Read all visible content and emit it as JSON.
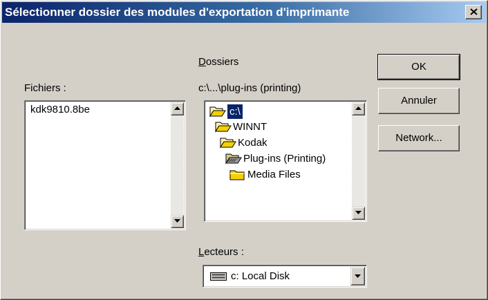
{
  "window": {
    "title": "Sélectionner dossier des modules d'exportation d'imprimante",
    "close_icon": "close-icon"
  },
  "files": {
    "label": "Fichiers :",
    "items": [
      "kdk9810.8be"
    ]
  },
  "folders": {
    "label_underlined": "D",
    "label_rest": "ossiers",
    "current_path": "c:\\...\\plug-ins (printing)",
    "items": [
      {
        "label": "c:\\",
        "icon": "open-folder-icon",
        "selected": true
      },
      {
        "label": "WINNT",
        "icon": "open-folder-icon",
        "selected": false
      },
      {
        "label": "Kodak",
        "icon": "open-folder-icon",
        "selected": false
      },
      {
        "label": "Plug-ins (Printing)",
        "icon": "open-folder-icon",
        "selected": false
      },
      {
        "label": "Media Files",
        "icon": "closed-folder-icon",
        "selected": false
      }
    ]
  },
  "drives": {
    "label_underlined": "L",
    "label_rest": "ecteurs :",
    "selected": "c: Local Disk",
    "icon": "hard-disk-icon"
  },
  "buttons": {
    "ok": "OK",
    "cancel": "Annuler",
    "network": "Network..."
  },
  "colors": {
    "title_bar_start": "#0a246a",
    "title_bar_end": "#a6caf0",
    "face": "#d4d0c8",
    "selection": "#0a246a"
  }
}
